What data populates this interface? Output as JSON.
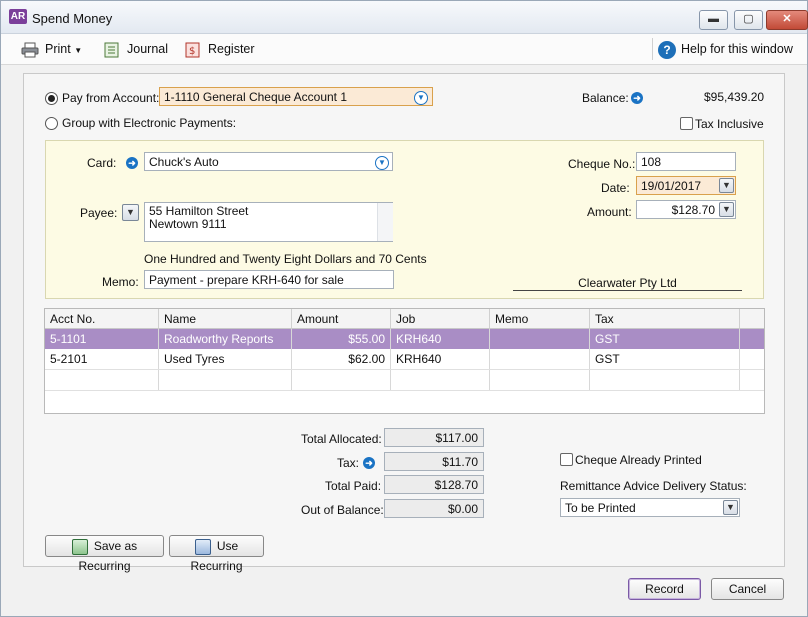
{
  "window": {
    "title": "Spend Money",
    "logo": "AR",
    "minimize": "▬",
    "maximize": "▢",
    "close": "✕"
  },
  "toolbar": {
    "print": "Print",
    "journal": "Journal",
    "register": "Register",
    "help": "Help for this window"
  },
  "pay_from": {
    "label": "Pay from Account:",
    "value": "1-1110 General Cheque Account 1",
    "selected": true
  },
  "group_payments": {
    "label": "Group with Electronic Payments:",
    "selected": false
  },
  "balance": {
    "label": "Balance:",
    "value": "$95,439.20"
  },
  "tax_inclusive": {
    "label": "Tax Inclusive",
    "checked": false
  },
  "card": {
    "label": "Card:",
    "value": "Chuck's Auto"
  },
  "payee": {
    "label": "Payee:",
    "line1": "55 Hamilton Street",
    "line2": "Newtown 9111"
  },
  "amount_words": "One Hundred and Twenty Eight Dollars and 70 Cents",
  "memo": {
    "label": "Memo:",
    "value": "Payment - prepare KRH-640 for sale"
  },
  "cheque_no": {
    "label": "Cheque No.:",
    "value": "108"
  },
  "date": {
    "label": "Date:",
    "value": "19/01/2017"
  },
  "amount": {
    "label": "Amount:",
    "value": "$128.70"
  },
  "company": "Clearwater Pty Ltd",
  "table": {
    "headers": [
      "Acct No.",
      "Name",
      "Amount",
      "Job",
      "Memo",
      "Tax"
    ],
    "rows": [
      [
        "5-1101",
        "Roadworthy Reports",
        "$55.00",
        "KRH640",
        "",
        "GST"
      ],
      [
        "5-2101",
        "Used Tyres",
        "$62.00",
        "KRH640",
        "",
        "GST"
      ]
    ]
  },
  "totals": {
    "allocated_label": "Total Allocated:",
    "allocated": "$117.00",
    "tax_label": "Tax:",
    "tax": "$11.70",
    "paid_label": "Total Paid:",
    "paid": "$128.70",
    "oob_label": "Out of Balance:",
    "oob": "$0.00"
  },
  "cheque_printed": {
    "label": "Cheque Already Printed",
    "checked": false
  },
  "remittance": {
    "label": "Remittance Advice Delivery Status:",
    "value": "To be Printed"
  },
  "buttons": {
    "save_recurring": "Save as Recurring",
    "use_recurring": "Use Recurring",
    "record": "Record",
    "cancel": "Cancel"
  },
  "colors": {
    "selected_row": "#a98dc5",
    "panel": "#fdfbe4",
    "accent": "#1a73c4"
  }
}
